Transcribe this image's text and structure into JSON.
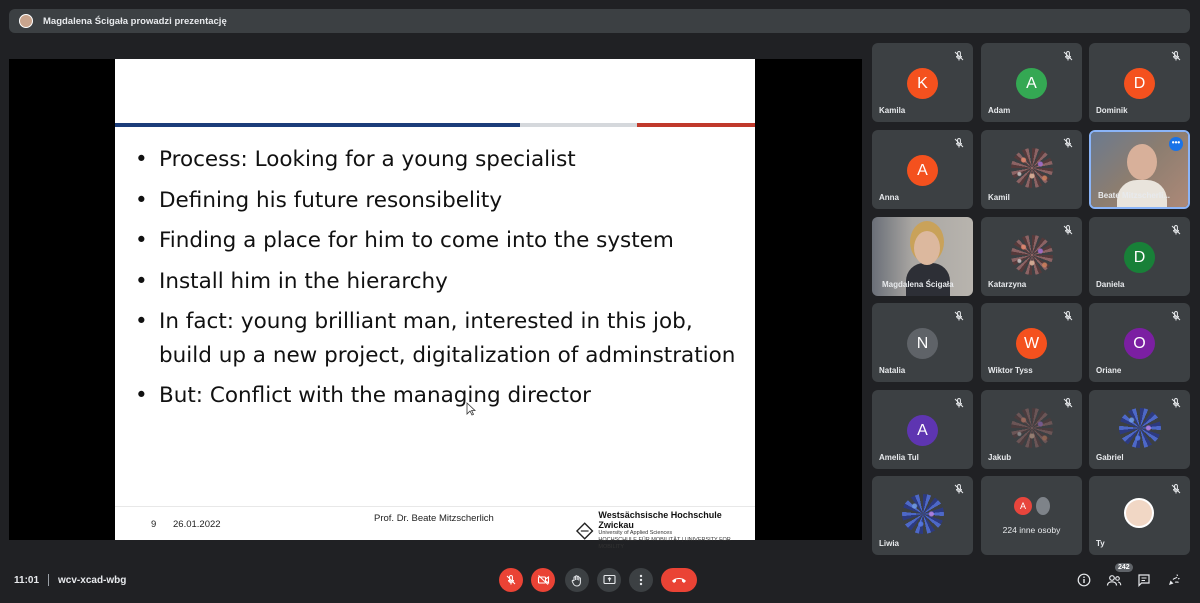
{
  "topbar": {
    "title": "Magdalena Ścigała prowadzi prezentację"
  },
  "slide": {
    "bullets": [
      "Process: Looking for a young specialist",
      "Defining his future resonsibelity",
      "Finding a place for him to come into the system",
      "Install him in the hierarchy",
      "In fact: young brilliant man, interested in this job, build up a new project, digitalization of adminstration",
      "But: Conflict with the managing director"
    ],
    "footer": {
      "page": "9",
      "date": "26.01.2022",
      "author": "Prof. Dr. Beate Mitzscherlich",
      "university": "Westsächsische Hochschule Zwickau",
      "university_sub1": "University of Applied Sciences",
      "university_sub2": "HOCHSCHULE FÜR MOBILITÄT | UNIVERSITY FOR MOBILITY"
    }
  },
  "participants": [
    {
      "name": "Kamila",
      "initial": "K",
      "color": "#f4511e"
    },
    {
      "name": "Adam",
      "initial": "A",
      "color": "#34a853"
    },
    {
      "name": "Dominik",
      "initial": "D",
      "color": "#f4511e"
    },
    {
      "name": "Anna",
      "initial": "A",
      "color": "#f4511e"
    },
    {
      "name": "Kamil"
    },
    {
      "name": "Beate Mitzscherli..."
    },
    {
      "name": "Magdalena Ścigała"
    },
    {
      "name": "Katarzyna"
    },
    {
      "name": "Daniela",
      "initial": "D",
      "color": "#188038"
    },
    {
      "name": "Natalia",
      "initial": "N",
      "color": "#5f6368"
    },
    {
      "name": "Wiktor Tyss",
      "initial": "W",
      "color": "#f4511e"
    },
    {
      "name": "Oriane",
      "initial": "O",
      "color": "#7b1fa2"
    },
    {
      "name": "Amelia Tul",
      "initial": "A",
      "color": "#5e35b1"
    },
    {
      "name": "Jakub"
    },
    {
      "name": "Gabriel"
    },
    {
      "name": "Liwia"
    },
    {
      "name": "224 inne osoby",
      "initial": "A",
      "color": "#e8453c"
    },
    {
      "name": "Ty"
    }
  ],
  "bottombar": {
    "time": "11:01",
    "meeting_code": "wcv-xcad-wbg",
    "people_count": "242"
  }
}
